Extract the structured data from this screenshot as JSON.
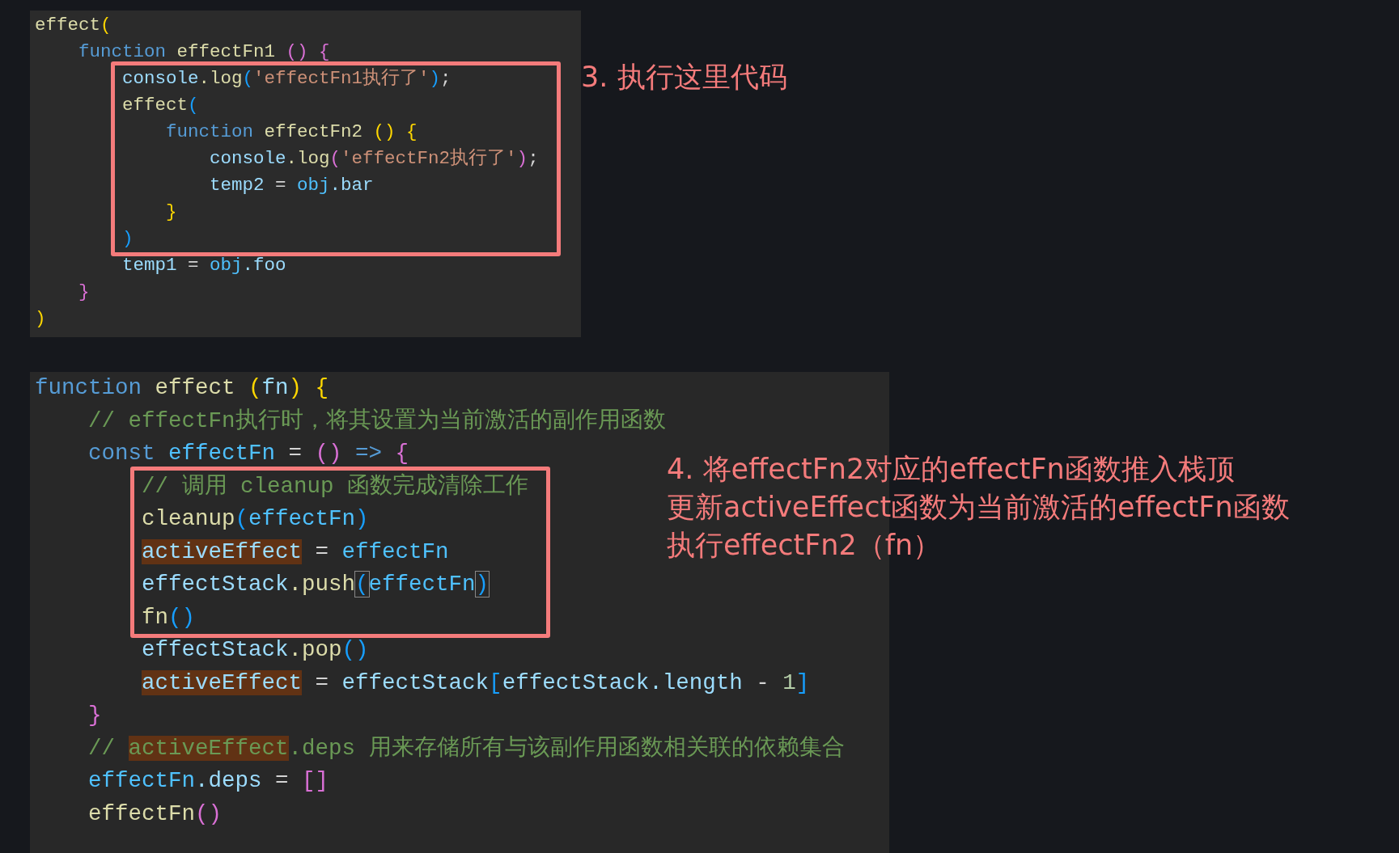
{
  "panels": [
    {
      "blocks": [
        {
          "boxed": false,
          "lines": [
            {
              "tokens": [
                {
                  "text": "effect",
                  "kind": "function"
                },
                {
                  "text": "(",
                  "kind": "paren-gold"
                }
              ]
            },
            {
              "tokens": [
                {
                  "text": "    function",
                  "kind": "keyword"
                },
                {
                  "text": " effectFn1 ",
                  "kind": "function"
                },
                {
                  "text": "()",
                  "kind": "paren-pink"
                },
                {
                  "text": " {",
                  "kind": "paren-pink"
                }
              ]
            }
          ]
        },
        {
          "boxed": true,
          "lines": [
            {
              "tokens": [
                {
                  "text": "        console",
                  "kind": "variable"
                },
                {
                  "text": ".log",
                  "kind": "function"
                },
                {
                  "text": "(",
                  "kind": "paren-blue"
                },
                {
                  "text": "'effectFn1执行了'",
                  "kind": "string"
                },
                {
                  "text": ")",
                  "kind": "paren-blue"
                },
                {
                  "text": ";",
                  "kind": "plain"
                }
              ]
            },
            {
              "tokens": [
                {
                  "text": "        effect",
                  "kind": "function"
                },
                {
                  "text": "(",
                  "kind": "paren-blue"
                }
              ]
            },
            {
              "tokens": [
                {
                  "text": "            function",
                  "kind": "keyword"
                },
                {
                  "text": " effectFn2 ",
                  "kind": "function"
                },
                {
                  "text": "()",
                  "kind": "paren-gold"
                },
                {
                  "text": " {",
                  "kind": "paren-gold"
                }
              ]
            },
            {
              "tokens": [
                {
                  "text": "                console",
                  "kind": "variable"
                },
                {
                  "text": ".log",
                  "kind": "function"
                },
                {
                  "text": "(",
                  "kind": "paren-pink"
                },
                {
                  "text": "'effectFn2执行了'",
                  "kind": "string"
                },
                {
                  "text": ")",
                  "kind": "paren-pink"
                },
                {
                  "text": ";",
                  "kind": "plain"
                }
              ]
            },
            {
              "tokens": [
                {
                  "text": "                temp2",
                  "kind": "variable"
                },
                {
                  "text": " = ",
                  "kind": "plain"
                },
                {
                  "text": "obj",
                  "kind": "constant"
                },
                {
                  "text": ".bar",
                  "kind": "variable"
                }
              ]
            },
            {
              "tokens": [
                {
                  "text": "            }",
                  "kind": "paren-gold"
                }
              ]
            },
            {
              "tokens": [
                {
                  "text": "        )",
                  "kind": "paren-blue"
                }
              ]
            }
          ]
        },
        {
          "boxed": false,
          "lines": [
            {
              "tokens": [
                {
                  "text": "        temp1",
                  "kind": "variable"
                },
                {
                  "text": " = ",
                  "kind": "plain"
                },
                {
                  "text": "obj",
                  "kind": "constant"
                },
                {
                  "text": ".foo",
                  "kind": "variable"
                }
              ]
            },
            {
              "tokens": [
                {
                  "text": "    }",
                  "kind": "paren-pink"
                }
              ]
            },
            {
              "tokens": [
                {
                  "text": ")",
                  "kind": "paren-gold"
                }
              ]
            }
          ]
        }
      ],
      "annotation": [
        "3. 执行这里代码"
      ]
    },
    {
      "blocks": [
        {
          "boxed": false,
          "lines": [
            {
              "tokens": [
                {
                  "text": "function",
                  "kind": "keyword"
                },
                {
                  "text": " effect ",
                  "kind": "function"
                },
                {
                  "text": "(",
                  "kind": "paren-gold"
                },
                {
                  "text": "fn",
                  "kind": "variable"
                },
                {
                  "text": ")",
                  "kind": "paren-gold"
                },
                {
                  "text": " {",
                  "kind": "paren-gold"
                }
              ]
            },
            {
              "tokens": [
                {
                  "text": "    // effectFn执行时，将其设置为当前激活的副作用函数",
                  "kind": "comment"
                }
              ]
            },
            {
              "tokens": [
                {
                  "text": "    const",
                  "kind": "keyword"
                },
                {
                  "text": " effectFn",
                  "kind": "constant"
                },
                {
                  "text": " = ",
                  "kind": "plain"
                },
                {
                  "text": "()",
                  "kind": "paren-pink"
                },
                {
                  "text": " => ",
                  "kind": "keyword"
                },
                {
                  "text": "{",
                  "kind": "paren-pink"
                }
              ]
            }
          ]
        },
        {
          "boxed": true,
          "lines": [
            {
              "tokens": [
                {
                  "text": "        // 调用 cleanup 函数完成清除工作",
                  "kind": "comment"
                }
              ]
            },
            {
              "tokens": [
                {
                  "text": "        cleanup",
                  "kind": "function"
                },
                {
                  "text": "(",
                  "kind": "paren-blue"
                },
                {
                  "text": "effectFn",
                  "kind": "constant"
                },
                {
                  "text": ")",
                  "kind": "paren-blue"
                }
              ]
            },
            {
              "tokens": [
                {
                  "text": "        activeEffect",
                  "kind": "highlight"
                },
                {
                  "text": " = ",
                  "kind": "plain"
                },
                {
                  "text": "effectFn",
                  "kind": "constant"
                }
              ]
            },
            {
              "tokens": [
                {
                  "text": "        effectStack",
                  "kind": "variable"
                },
                {
                  "text": ".push",
                  "kind": "function"
                },
                {
                  "text": "(",
                  "kind": "bracket-match"
                },
                {
                  "text": "effectFn",
                  "kind": "constant"
                },
                {
                  "text": ")",
                  "kind": "bracket-match"
                }
              ]
            },
            {
              "tokens": [
                {
                  "text": "        fn",
                  "kind": "function"
                },
                {
                  "text": "()",
                  "kind": "paren-blue"
                }
              ]
            }
          ]
        },
        {
          "boxed": false,
          "lines": [
            {
              "tokens": [
                {
                  "text": "        effectStack",
                  "kind": "variable"
                },
                {
                  "text": ".pop",
                  "kind": "function"
                },
                {
                  "text": "()",
                  "kind": "paren-blue"
                }
              ]
            },
            {
              "tokens": [
                {
                  "text": "        activeEffect",
                  "kind": "highlight"
                },
                {
                  "text": " = ",
                  "kind": "plain"
                },
                {
                  "text": "effectStack",
                  "kind": "variable"
                },
                {
                  "text": "[",
                  "kind": "paren-blue"
                },
                {
                  "text": "effectStack",
                  "kind": "variable"
                },
                {
                  "text": ".length",
                  "kind": "variable"
                },
                {
                  "text": " - ",
                  "kind": "plain"
                },
                {
                  "text": "1",
                  "kind": "number"
                },
                {
                  "text": "]",
                  "kind": "paren-blue"
                }
              ]
            },
            {
              "tokens": [
                {
                  "text": "    }",
                  "kind": "paren-pink"
                }
              ]
            },
            {
              "tokens": [
                {
                  "text": "    // ",
                  "kind": "comment"
                },
                {
                  "text": "activeEffect",
                  "kind": "highlight-comment"
                },
                {
                  "text": ".deps 用来存储所有与该副作用函数相关联的依赖集合",
                  "kind": "comment"
                }
              ]
            },
            {
              "tokens": [
                {
                  "text": "    effectFn",
                  "kind": "constant"
                },
                {
                  "text": ".deps",
                  "kind": "variable"
                },
                {
                  "text": " = ",
                  "kind": "plain"
                },
                {
                  "text": "[]",
                  "kind": "paren-pink"
                }
              ]
            },
            {
              "tokens": [
                {
                  "text": "    effectFn",
                  "kind": "function"
                },
                {
                  "text": "()",
                  "kind": "paren-pink"
                }
              ]
            }
          ]
        }
      ],
      "annotation": [
        "4. 将effectFn2对应的effectFn函数推入栈顶",
        "更新activeEffect函数为当前激活的effectFn函数",
        "执行effectFn2（fn）"
      ]
    }
  ]
}
